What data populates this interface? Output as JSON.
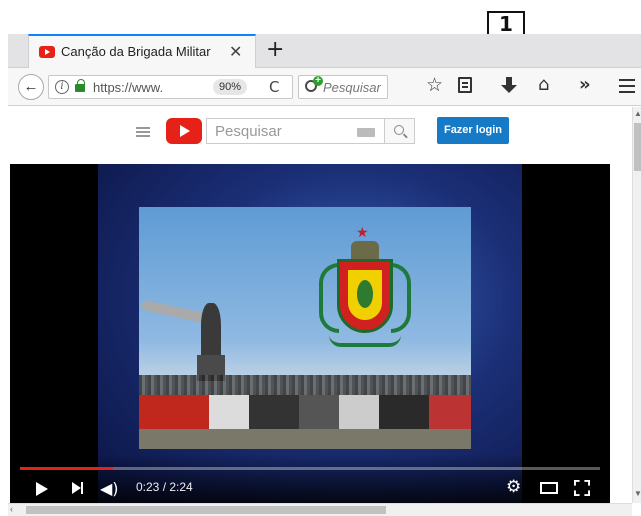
{
  "callout": {
    "number": "1"
  },
  "browser": {
    "tab": {
      "title": "Canção da Brigada Militar -",
      "favicon": "youtube-favicon-icon",
      "close_glyph": "✕"
    },
    "new_tab_glyph": "+",
    "nav": {
      "back_glyph": "←",
      "url": "https://www.",
      "zoom": "90%",
      "reload_glyph": "C",
      "search_placeholder": "Pesquisar",
      "star_glyph": "☆",
      "home_glyph": "⌂",
      "overflow_glyph": "»"
    }
  },
  "youtube": {
    "search_placeholder": "Pesquisar",
    "login_label": "Fazer login",
    "brand_color": "#e62117",
    "login_color": "#167ac6"
  },
  "player": {
    "current_time": "0:23",
    "duration": "2:24",
    "time_display": "0:23 / 2:24",
    "progress_fraction": 0.16,
    "volume_glyph": "◀)",
    "gear_glyph": "⚙"
  },
  "scrollbar": {
    "up_glyph": "▲",
    "down_glyph": "▼",
    "left_glyph": "‹"
  }
}
